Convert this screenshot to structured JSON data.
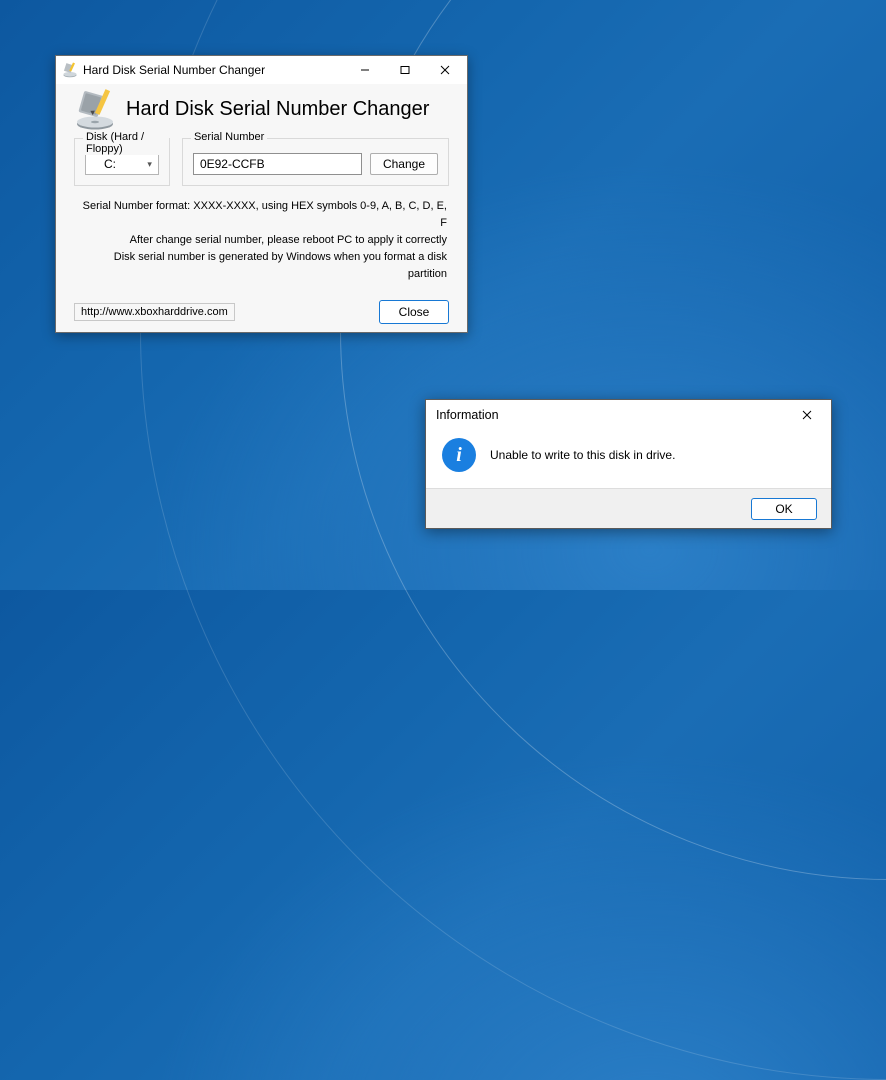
{
  "main_window": {
    "title": "Hard Disk Serial Number Changer",
    "heading": "Hard Disk Serial Number Changer",
    "disk_group_label": "Disk (Hard / Floppy)",
    "disk_selected": "C:",
    "serial_group_label": "Serial Number",
    "serial_value": "0E92-CCFB",
    "change_button": "Change",
    "info_line1": "Serial Number format: XXXX-XXXX, using HEX symbols 0-9, A, B, C, D, E, F",
    "info_line2": "After change serial number, please reboot PC to apply it correctly",
    "info_line3": "Disk serial number is generated by Windows when you format a disk partition",
    "url_text": "http://www.xboxharddrive.com",
    "close_button": "Close"
  },
  "dialog": {
    "title": "Information",
    "message": "Unable to write to this disk in drive.",
    "ok_button": "OK"
  }
}
